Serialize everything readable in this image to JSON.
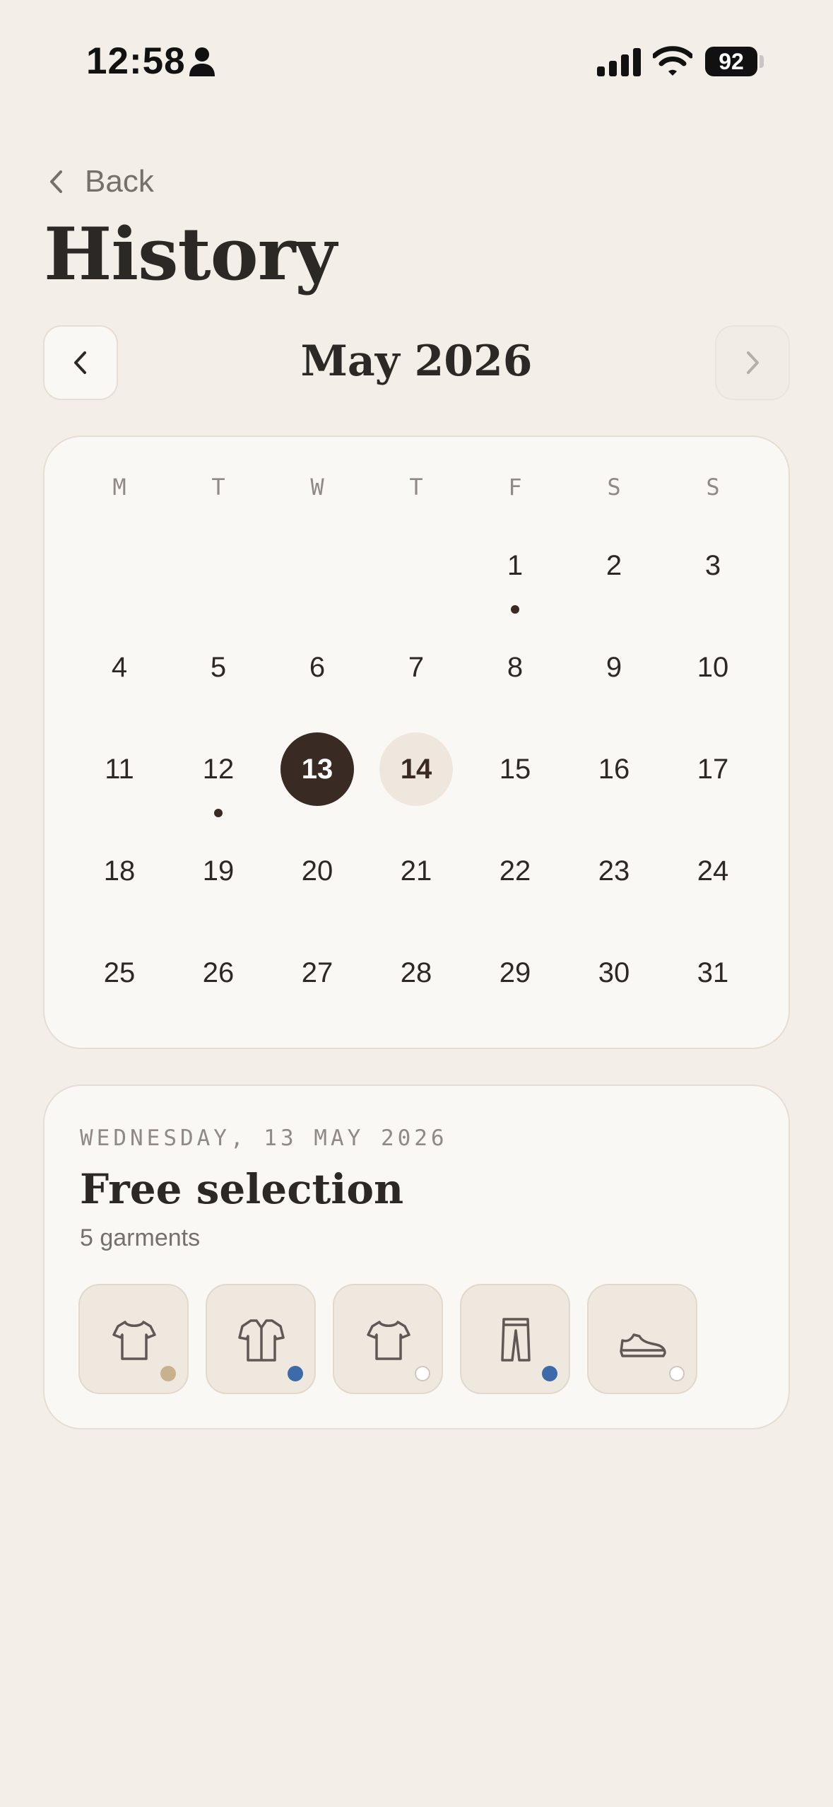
{
  "status_bar": {
    "time": "12:58",
    "battery": "92"
  },
  "back_label": "Back",
  "title": "History",
  "calendar": {
    "month_label": "May 2026",
    "weekdays": [
      "M",
      "T",
      "W",
      "T",
      "F",
      "S",
      "S"
    ],
    "days": [
      "1",
      "2",
      "3",
      "4",
      "5",
      "6",
      "7",
      "8",
      "9",
      "10",
      "11",
      "12",
      "13",
      "14",
      "15",
      "16",
      "17",
      "18",
      "19",
      "20",
      "21",
      "22",
      "23",
      "24",
      "25",
      "26",
      "27",
      "28",
      "29",
      "30",
      "31"
    ],
    "first_weekday_index": 4,
    "selected_day": 13,
    "today_day": 14,
    "days_with_entries": [
      1,
      12
    ]
  },
  "detail": {
    "date_label": "WEDNESDAY, 13 MAY 2026",
    "title": "Free selection",
    "count_label": "5 garments",
    "garments": [
      {
        "icon": "tshirt-icon",
        "color": "#c9b08f"
      },
      {
        "icon": "shirt-icon",
        "color": "#3d6aa8"
      },
      {
        "icon": "tshirt-icon",
        "color": "#ffffff"
      },
      {
        "icon": "pants-icon",
        "color": "#3d6aa8"
      },
      {
        "icon": "sneaker-icon",
        "color": "#ffffff"
      }
    ]
  },
  "colors": {
    "background": "#f4eee8",
    "card": "#faf8f4",
    "accent_dark": "#3a2a24",
    "today_highlight": "#efe7de"
  }
}
